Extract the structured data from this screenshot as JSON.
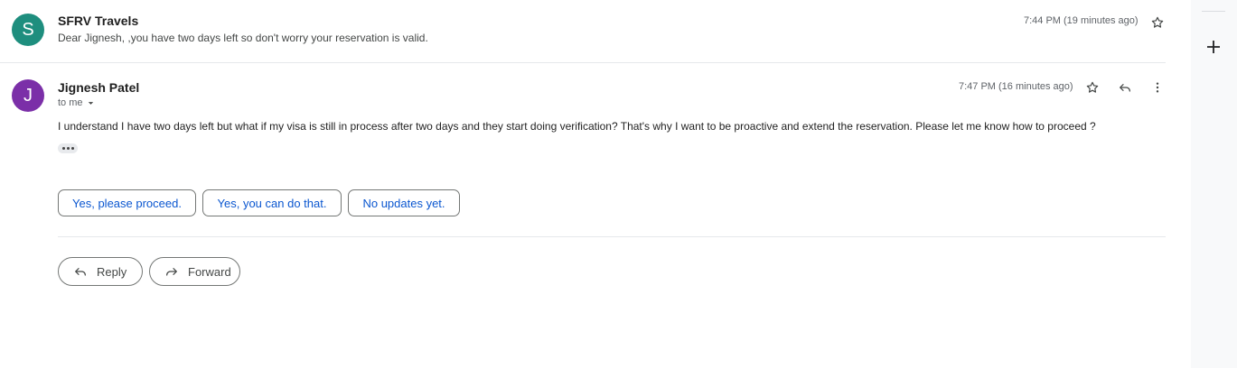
{
  "colors": {
    "avatar_s": "#1e8e7e",
    "avatar_j": "#7b2fa8",
    "link_blue": "#0b57d0"
  },
  "message1": {
    "avatar_letter": "S",
    "sender": "SFRV Travels",
    "snippet": "Dear Jignesh, ,you have two days left so don't worry your reservation is valid.",
    "time": "7:44 PM (19 minutes ago)"
  },
  "message2": {
    "avatar_letter": "J",
    "sender": "Jignesh Patel",
    "recipient": "to me",
    "time": "7:47 PM (16 minutes ago)",
    "body": "I understand I have two days left but what if my visa is still in process after two days and they start doing verification? That's why I want to be proactive and extend the reservation. Please let me know how to proceed ?"
  },
  "smart_replies": [
    "Yes, please proceed.",
    "Yes, you can do that.",
    "No updates yet."
  ],
  "actions": {
    "reply_label": "Reply",
    "forward_label": "Forward"
  },
  "icons": [
    "star-icon",
    "reply-icon",
    "more-vert-icon",
    "chevron-down-icon",
    "forward-icon",
    "plus-icon"
  ]
}
